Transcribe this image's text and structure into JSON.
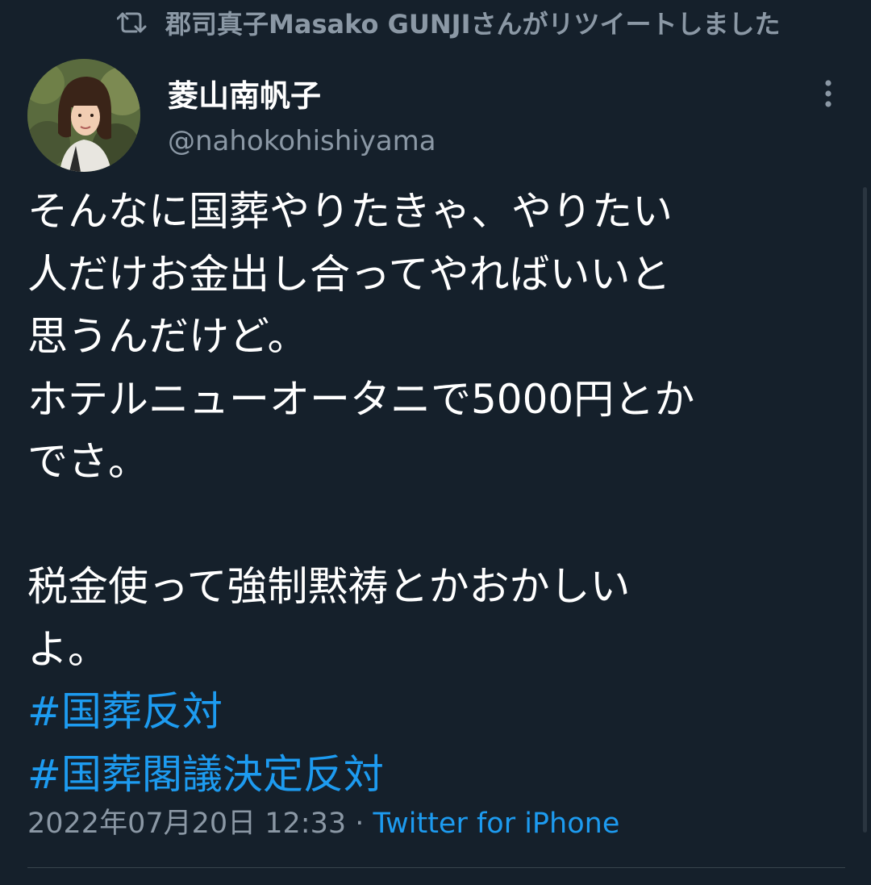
{
  "retweet": {
    "icon": "retweet-icon",
    "text": "郡司真子Masako GUNJIさんがリツイートしました"
  },
  "author": {
    "avatar": "avatar",
    "display_name": "菱山南帆子",
    "handle": "@nahokohishiyama"
  },
  "tweet": {
    "lines": [
      "そんなに国葬やりたきゃ、やりたい",
      "人だけお金出し合ってやればいいと",
      "思うんだけど。",
      "ホテルニューオータニで5000円とか",
      "でさ。",
      "",
      "税金使って強制黙祷とかおかしい",
      "よ。"
    ],
    "hashtags": [
      "#国葬反対",
      "#国葬閣議決定反対"
    ]
  },
  "meta": {
    "timestamp": "2022年07月20日 12:33",
    "separator": " · ",
    "source": "Twitter for iPhone"
  },
  "colors": {
    "background": "#15202b",
    "text": "#ffffff",
    "secondary": "#8b98a5",
    "link": "#1d9bf0",
    "divider": "#38444d"
  }
}
